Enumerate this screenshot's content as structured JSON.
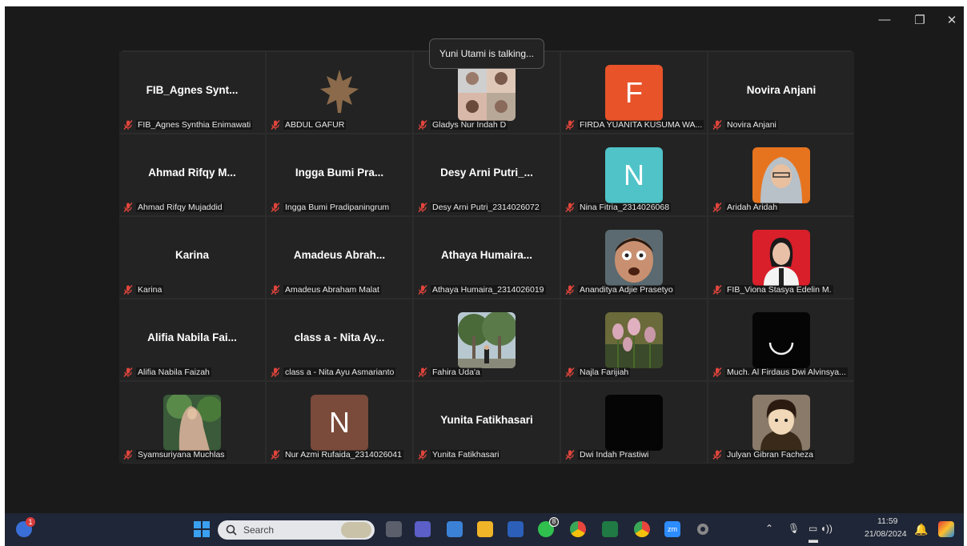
{
  "window_controls": {
    "minimize": "—",
    "restore": "❐",
    "close": "✕"
  },
  "talking_notice": "Yuni Utami is talking...",
  "participants": [
    {
      "label": "FIB_Agnes Synthia Enimawati",
      "display": "FIB_Agnes Synt..."
    },
    {
      "label": "ABDUL GAFUR",
      "avatar": "maple-leaf"
    },
    {
      "label": "Gladys Nur Indah D",
      "avatar": "photo-collage"
    },
    {
      "label": "FIRDA YUANITA KUSUMA WA...",
      "letter": "F",
      "color": "#e8532a"
    },
    {
      "label": "Novira Anjani",
      "display": "Novira Anjani"
    },
    {
      "label": "Ahmad Rifqy Mujaddid",
      "display": "Ahmad Rifqy M..."
    },
    {
      "label": "Ingga Bumi Pradipaningrum",
      "display": "Ingga Bumi Pra..."
    },
    {
      "label": "Desy Arni Putri_2314026072",
      "display": "Desy Arni Putri_..."
    },
    {
      "label": "Nina Fitria_2314026068",
      "letter": "N",
      "color": "#4fc3c8"
    },
    {
      "label": "Aridah Aridah",
      "avatar": "hijab-portrait"
    },
    {
      "label": "Karina",
      "display": "Karina"
    },
    {
      "label": "Amadeus Abraham Malat",
      "display": "Amadeus Abrah..."
    },
    {
      "label": "Athaya Humaira_2314026019",
      "display": "Athaya Humaira..."
    },
    {
      "label": "Ananditya Adjie Prasetyo",
      "avatar": "man-portrait"
    },
    {
      "label": "FIB_Viona Stasya Edelin M.",
      "avatar": "red-portrait"
    },
    {
      "label": "Alifia Nabila Faizah",
      "display": "Alifia Nabila Fai..."
    },
    {
      "label": "class a - Nita Ayu Asmarianto",
      "display": "class a - Nita Ay..."
    },
    {
      "label": "Fahira Uda'a",
      "avatar": "tree-photo"
    },
    {
      "label": "Najla Farijiah",
      "avatar": "tulip-photo"
    },
    {
      "label": "Much. Al Firdaus Dwi Alvinsya...",
      "avatar": "loading-ring"
    },
    {
      "label": "Syamsuriyana Muchlas",
      "avatar": "hijab-outdoor"
    },
    {
      "label": "Nur Azmi Rufaida_2314026041",
      "letter": "N",
      "color": "#7a4a3a"
    },
    {
      "label": "Yunita Fatikhasari",
      "display": "Yunita Fatikhasari"
    },
    {
      "label": "Dwi Indah Prastiwi",
      "avatar": "black-square"
    },
    {
      "label": "Julyan Gibran Facheza",
      "avatar": "anime-avatar"
    }
  ],
  "taskbar": {
    "weather_badge": "1",
    "search_placeholder": "Search",
    "whatsapp_badge": "8",
    "zoom_label": "zm",
    "time": "11:59",
    "date": "21/08/2024"
  }
}
